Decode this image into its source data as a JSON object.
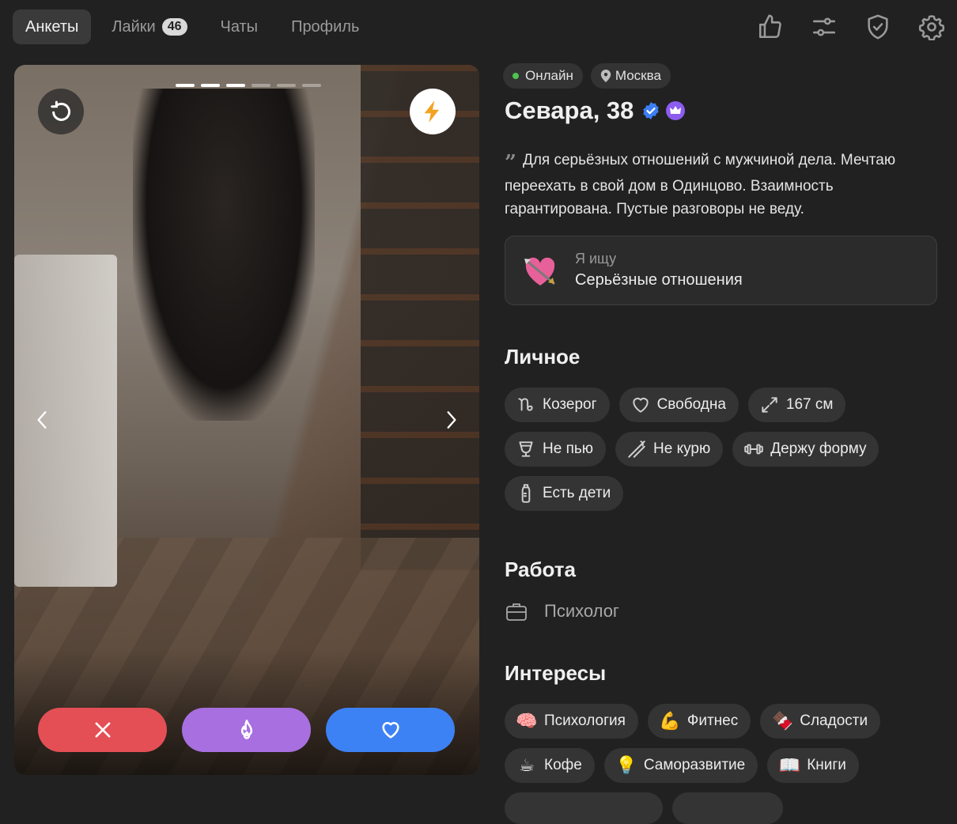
{
  "nav": {
    "tabs": [
      {
        "label": "Анкеты",
        "active": true
      },
      {
        "label": "Лайки",
        "badge": "46"
      },
      {
        "label": "Чаты"
      },
      {
        "label": "Профиль"
      }
    ]
  },
  "header_icons": [
    "thumbs-up-icon",
    "sliders-icon",
    "shield-check-icon",
    "gear-icon"
  ],
  "photo": {
    "slides_total": 6,
    "slide_current": 3
  },
  "actions": [
    "dislike",
    "super-like",
    "like"
  ],
  "colors": {
    "background": "#212121",
    "dislike": "#e34f55",
    "superlike": "#a86fe0",
    "like": "#3d82f5",
    "online": "#4fc24f",
    "boost": "#f2a321"
  },
  "profile": {
    "status": "Онлайн",
    "city": "Москва",
    "name_age": "Севара, 38",
    "bio": "Для серьёзных отношений с мужчиной дела. Мечтаю переехать в свой дом в Одинцово. Взаимность гарантирована. Пустые разговоры не веду.",
    "seeking_label": "Я ищу",
    "seeking_value": "Серьёзные отношения"
  },
  "sections": {
    "personal_title": "Личное",
    "work_title": "Работа",
    "interests_title": "Интересы"
  },
  "personal": [
    {
      "icon": "capricorn-icon",
      "label": "Козерог"
    },
    {
      "icon": "heart-outline-icon",
      "label": "Свободна"
    },
    {
      "icon": "height-icon",
      "label": "167 см"
    },
    {
      "icon": "glass-icon",
      "label": "Не пью"
    },
    {
      "icon": "no-smoking-icon",
      "label": "Не курю"
    },
    {
      "icon": "dumbbell-icon",
      "label": "Держу форму"
    },
    {
      "icon": "baby-bottle-icon",
      "label": "Есть дети"
    }
  ],
  "work": {
    "label": "Психолог"
  },
  "interests": [
    {
      "emoji": "🧠",
      "label": "Психология"
    },
    {
      "emoji": "💪",
      "label": "Фитнес"
    },
    {
      "emoji": "🍫",
      "label": "Сладости"
    },
    {
      "emoji": "☕",
      "label": "Кофе"
    },
    {
      "emoji": "💡",
      "label": "Саморазвитие"
    },
    {
      "emoji": "📖",
      "label": "Книги"
    }
  ]
}
